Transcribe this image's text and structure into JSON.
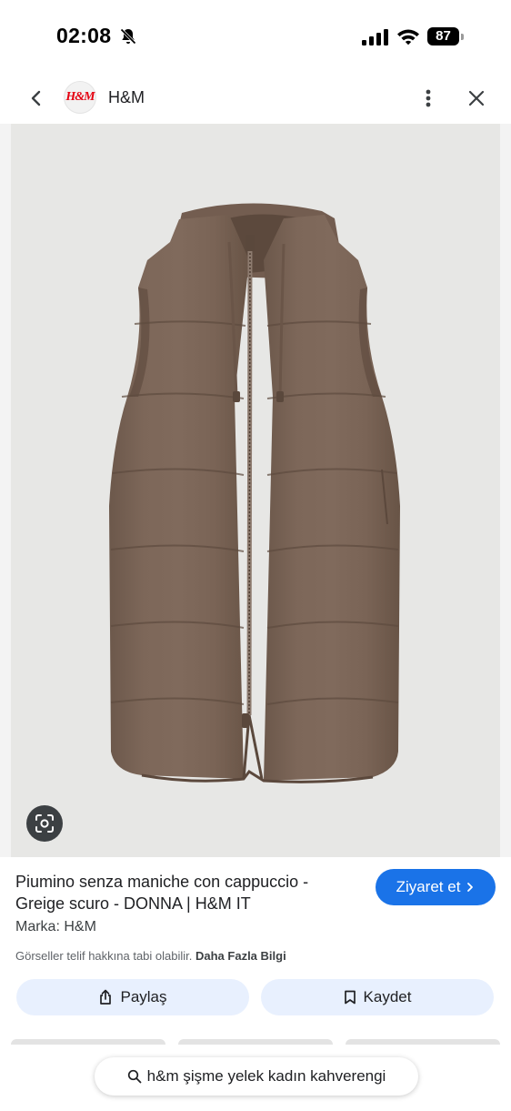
{
  "status_bar": {
    "time": "02:08",
    "battery": "87"
  },
  "header": {
    "logo_text": "H&M",
    "site_name": "H&M"
  },
  "result": {
    "title": "Piumino senza maniche con cappuccio - Greige scuro - DONNA | H&M IT",
    "visit_label": "Ziyaret et",
    "brand": "Marka: H&M",
    "copyright": "Görseller telif hakkına tabi olabilir.",
    "more_info": "Daha Fazla Bilgi",
    "share_label": "Paylaş",
    "save_label": "Kaydet"
  },
  "search": {
    "query": "h&m şişme yelek kadın kahverengi"
  },
  "colors": {
    "accent": "#1a73e8",
    "chip_bg": "#e8f0fe",
    "vest": "#7b6557",
    "brand_red": "#e50010"
  },
  "icons": [
    "bell-slash-icon",
    "signal-icon",
    "wifi-icon",
    "battery-icon",
    "back-icon",
    "more-vert-icon",
    "close-icon",
    "lens-icon",
    "chevron-right-icon",
    "share-icon",
    "bookmark-icon",
    "search-icon"
  ]
}
